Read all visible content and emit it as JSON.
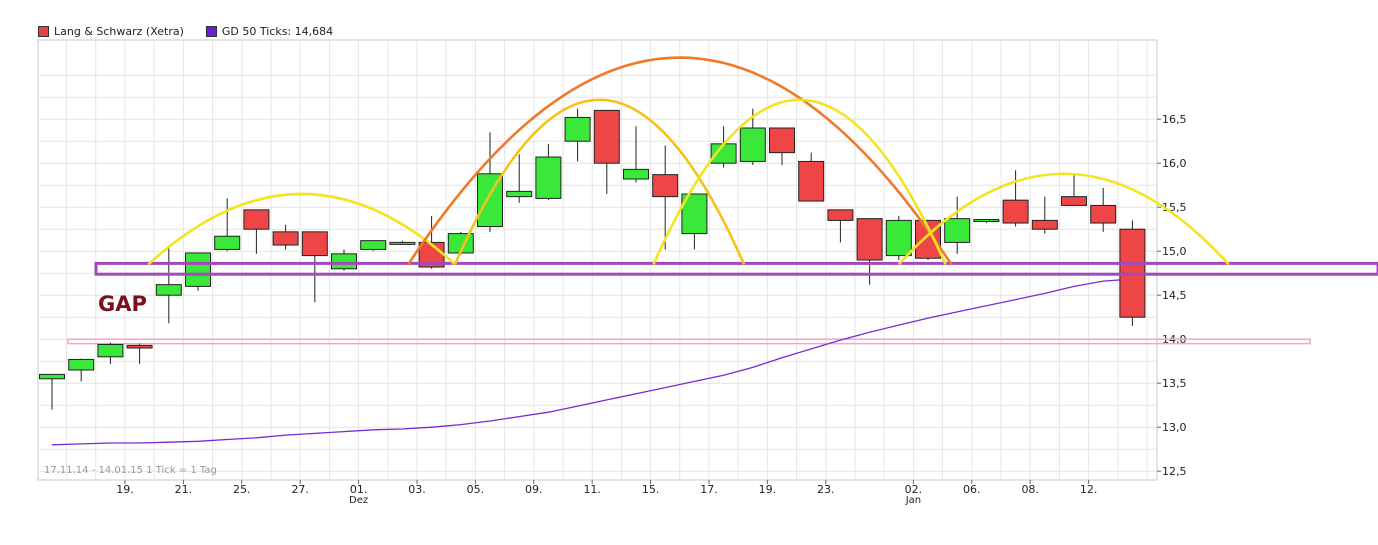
{
  "legend": {
    "series1_label": "Lang & Schwarz (Xetra)",
    "series1_color": "#e84040",
    "series2_label": "GD 50 Ticks: 14,684",
    "series2_color": "#6a1fd0"
  },
  "info_text": "17.11.14 - 14.01.15   1 Tick = 1 Tag",
  "chart_data": {
    "type": "candlestick",
    "ylim": [
      12.4,
      17.4
    ],
    "y_ticks": [
      "12,5",
      "13,0",
      "13,5",
      "14,0",
      "14,5",
      "15,0",
      "15,5",
      "16,0",
      "16,5"
    ],
    "y_tick_values": [
      12.5,
      13.0,
      13.5,
      14.0,
      14.5,
      15.0,
      15.5,
      16.0,
      16.5
    ],
    "x_ticks": [
      {
        "i": 2.5,
        "label": "19."
      },
      {
        "i": 4.5,
        "label": "21."
      },
      {
        "i": 6.5,
        "label": "25."
      },
      {
        "i": 8.5,
        "label": "27."
      },
      {
        "i": 10.5,
        "label": "01.",
        "sub": "Dez"
      },
      {
        "i": 12.5,
        "label": "03."
      },
      {
        "i": 14.5,
        "label": "05."
      },
      {
        "i": 16.5,
        "label": "09."
      },
      {
        "i": 18.5,
        "label": "11."
      },
      {
        "i": 20.5,
        "label": "15."
      },
      {
        "i": 22.5,
        "label": "17."
      },
      {
        "i": 24.5,
        "label": "19."
      },
      {
        "i": 26.5,
        "label": "23."
      },
      {
        "i": 29.5,
        "label": "02.",
        "sub": "Jan"
      },
      {
        "i": 31.5,
        "label": "06."
      },
      {
        "i": 33.5,
        "label": "08."
      },
      {
        "i": 35.5,
        "label": "12."
      }
    ],
    "candles": [
      {
        "o": 13.55,
        "h": 13.6,
        "l": 13.2,
        "c": 13.6
      },
      {
        "o": 13.65,
        "h": 13.78,
        "l": 13.52,
        "c": 13.77
      },
      {
        "o": 13.8,
        "h": 13.96,
        "l": 13.72,
        "c": 13.94
      },
      {
        "o": 13.93,
        "h": 13.95,
        "l": 13.72,
        "c": 13.9
      },
      {
        "o": 14.5,
        "h": 15.05,
        "l": 14.18,
        "c": 14.62
      },
      {
        "o": 14.6,
        "h": 14.98,
        "l": 14.55,
        "c": 14.98
      },
      {
        "o": 15.02,
        "h": 15.6,
        "l": 15.0,
        "c": 15.17
      },
      {
        "o": 15.47,
        "h": 15.47,
        "l": 14.97,
        "c": 15.25
      },
      {
        "o": 15.22,
        "h": 15.3,
        "l": 15.02,
        "c": 15.07
      },
      {
        "o": 15.22,
        "h": 15.22,
        "l": 14.42,
        "c": 14.95
      },
      {
        "o": 14.8,
        "h": 15.02,
        "l": 14.78,
        "c": 14.97
      },
      {
        "o": 15.02,
        "h": 15.12,
        "l": 15.0,
        "c": 15.12
      },
      {
        "o": 15.1,
        "h": 15.12,
        "l": 15.08,
        "c": 15.1
      },
      {
        "o": 15.1,
        "h": 15.4,
        "l": 14.8,
        "c": 14.82
      },
      {
        "o": 14.98,
        "h": 15.22,
        "l": 14.96,
        "c": 15.2
      },
      {
        "o": 15.28,
        "h": 16.35,
        "l": 15.22,
        "c": 15.88
      },
      {
        "o": 15.62,
        "h": 16.1,
        "l": 15.55,
        "c": 15.68
      },
      {
        "o": 15.6,
        "h": 16.22,
        "l": 15.58,
        "c": 16.07
      },
      {
        "o": 16.25,
        "h": 16.62,
        "l": 16.02,
        "c": 16.52
      },
      {
        "o": 16.6,
        "h": 16.6,
        "l": 15.65,
        "c": 16.0
      },
      {
        "o": 15.82,
        "h": 16.42,
        "l": 15.78,
        "c": 15.93
      },
      {
        "o": 15.87,
        "h": 16.2,
        "l": 15.02,
        "c": 15.62
      },
      {
        "o": 15.2,
        "h": 15.65,
        "l": 15.02,
        "c": 15.65
      },
      {
        "o": 16.0,
        "h": 16.42,
        "l": 15.95,
        "c": 16.22
      },
      {
        "o": 16.02,
        "h": 16.62,
        "l": 15.98,
        "c": 16.4
      },
      {
        "o": 16.4,
        "h": 16.4,
        "l": 15.98,
        "c": 16.12
      },
      {
        "o": 16.02,
        "h": 16.12,
        "l": 15.57,
        "c": 15.57
      },
      {
        "o": 15.47,
        "h": 15.47,
        "l": 15.1,
        "c": 15.35
      },
      {
        "o": 15.37,
        "h": 15.37,
        "l": 14.62,
        "c": 14.9
      },
      {
        "o": 14.95,
        "h": 15.4,
        "l": 14.9,
        "c": 15.35
      },
      {
        "o": 15.35,
        "h": 15.35,
        "l": 14.9,
        "c": 14.92
      },
      {
        "o": 15.1,
        "h": 15.62,
        "l": 14.97,
        "c": 15.37
      },
      {
        "o": 15.35,
        "h": 15.35,
        "l": 15.32,
        "c": 15.36
      },
      {
        "o": 15.58,
        "h": 15.92,
        "l": 15.28,
        "c": 15.32
      },
      {
        "o": 15.35,
        "h": 15.62,
        "l": 15.2,
        "c": 15.25
      },
      {
        "o": 15.62,
        "h": 15.88,
        "l": 15.52,
        "c": 15.52
      },
      {
        "o": 15.52,
        "h": 15.72,
        "l": 15.22,
        "c": 15.32
      },
      {
        "o": 15.25,
        "h": 15.35,
        "l": 14.15,
        "c": 14.25
      }
    ],
    "ma_series": {
      "name": "GD 50 Ticks",
      "values": [
        12.8,
        12.81,
        12.82,
        12.82,
        12.83,
        12.84,
        12.86,
        12.88,
        12.91,
        12.93,
        12.95,
        12.97,
        12.98,
        13.0,
        13.03,
        13.07,
        13.12,
        13.17,
        13.24,
        13.31,
        13.38,
        13.45,
        13.52,
        13.59,
        13.68,
        13.79,
        13.89,
        13.99,
        14.08,
        14.16,
        14.24,
        14.31,
        14.38,
        14.45,
        14.52,
        14.6,
        14.66,
        14.684
      ]
    },
    "annotations": {
      "gap_label": "GAP",
      "support_band": [
        14.75,
        14.85
      ],
      "gap_band": [
        13.95,
        14.0
      ],
      "arcs": [
        {
          "from": 3.3,
          "to": 13.8,
          "peak": 15.65,
          "color": "#f2e420"
        },
        {
          "from": 12.2,
          "to": 22.7,
          "peak": 17.2,
          "color": "#f07a28"
        },
        {
          "from": 13.8,
          "to": 21.8,
          "peak": 16.72,
          "color": "#f4c218"
        },
        {
          "from": 21.5,
          "to": 23.7,
          "peak": 16.72,
          "color": "#f2e420",
          "partial_start": 20.5
        },
        {
          "from": 22.3,
          "to": 27.5,
          "peak": 16.72,
          "color": "#f2e420"
        },
        {
          "from": 27.5,
          "to": 29.5,
          "peak": 16.72,
          "color": "#f2e420"
        },
        {
          "from": 29.5,
          "to": 30.8,
          "peak": 15.2,
          "color": "#f2e420"
        },
        {
          "from": 28.0,
          "to": 40.3,
          "peak": 15.88,
          "color": "#f2e420"
        }
      ]
    }
  }
}
